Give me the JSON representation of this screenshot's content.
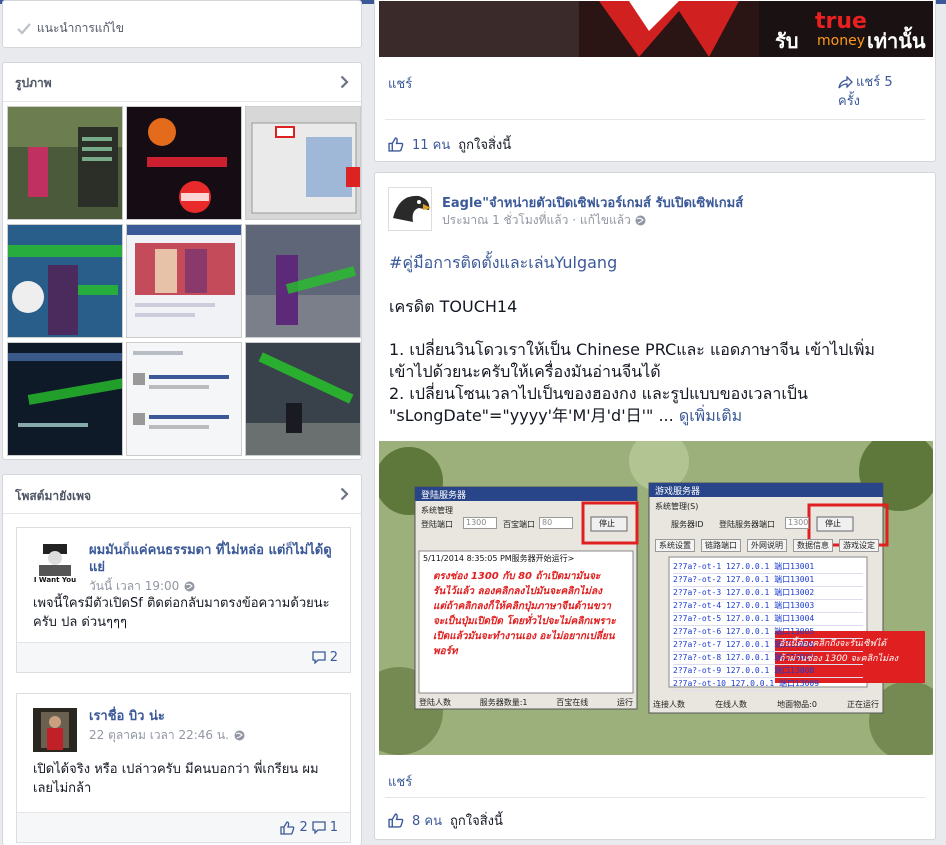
{
  "suggest": {
    "label": "แนะนำการแก้ไข"
  },
  "photos": {
    "title": "รูปภาพ"
  },
  "posts_to_page": {
    "title": "โพสต์มายังเพจ",
    "items": [
      {
        "name": "ผมมันก็แค่คนธรรมดา ที่ไม่หล่อ แต่ก็ไม่ได้ดูแย่",
        "time": "วันนี้ เวลา 19:00",
        "avatar_text": "I Want You",
        "message": "เพจนี้ใครมีตัวเปิดSf ติดต่อกลับมาตรงข้อความด้วยนะครับ ปล ด่วนๆๆๆ",
        "comments": "2"
      },
      {
        "name": "เราชื่อ บิว น่ะ",
        "time": "22 ตุลาคม เวลา 22:46 น.",
        "message": "เปิดได้จริง หรือ เปล่าวครับ มีคนบอกว่า พี่เกรียน ผมเลยไม่กล้า",
        "likes": "2",
        "comments": "1"
      }
    ]
  },
  "top_post": {
    "banner_text": "รับ",
    "banner_brand_top": "true",
    "banner_brand_bottom": "money",
    "banner_tail": "เท่านั้น",
    "share_label": "แชร์",
    "share_count_label": "แชร์ 5",
    "share_count_unit": "ครั้ง",
    "like_count": "11 คน",
    "like_text": "ถูกใจสิ่งนี้"
  },
  "main_post": {
    "author": "Eagle\"จำหน่ายตัวเปิดเซิฟเวอร์เกมส์ รับเปิดเซิฟเกมส์",
    "meta": "ประมาณ 1 ชั่วโมงที่แล้ว · แก้ไขแล้ว",
    "hashtag": "#คู่มือการติดตั้งและเล่นYulgang",
    "credit": "เครดิต TOUCH14",
    "line1": "1. เปลี่ยนวินโดวเราให้เป็น Chinese PRCและ แอดภาษาจีน เข้าไปเพิ่ม",
    "line2": "เข้าไปด้วยนะครับให้เครื่องมันอ่านจีนได้",
    "line3": "2. เปลี่ยนโซนเวลาไปเป็นของฮองกง และรูปแบบของเวลาเป็น",
    "line4_pre": "\"sLongDate\"=\"yyyy'年'M'月'd'日'\" ... ",
    "see_more": "ดูเพิ่มเติม",
    "share_label": "แชร์",
    "like_count": "8 คน",
    "like_text": "ถูกใจสิ่งนี้",
    "screenshot": {
      "left_window_title": "登陆服务器",
      "left_tab": "系统管理",
      "login_port_label": "登陆端口",
      "login_port_value": "1300",
      "server_port_label": "百宝端口",
      "server_port_value": "80",
      "stop_button": "停止",
      "log_line": "5/11/2014 8:35:05 PM服务器开始运行>",
      "overlay_text_1": "ตรงช่อง 1300 กับ 80 ถ้าเปิดมามันจะ",
      "overlay_text_2": "รันไว้แล้ว ลองคลิกลงไปมันจะคลิกไม่ลง",
      "overlay_text_3": "แต่ถ้าคลิกลงก็ให้คลิกปุ่มภาษาจีนด้านขวา",
      "overlay_text_4": "จะเป็นปุ่มเปิดปิด โดยทั่วไปจะไม่คลิกเพราะ",
      "overlay_text_5": "เปิดแล้วมันจะทำงานเอง อะไม่อยากเปลี่ยน",
      "overlay_text_6": "พอร์ท",
      "left_status_1": "登陆人数",
      "left_status_2": "服务器数量:1",
      "left_status_3": "百宝在线",
      "left_status_4": "运行",
      "right_window_title": "游戏服务器",
      "right_tab": "系统管理(S)",
      "right_port_label": "服务器ID",
      "right_server_port_label": "登陆服务器端口",
      "right_port_value": "1300",
      "right_stop_button": "停止",
      "right_tabs": [
        "系统设置",
        "链路端口",
        "外网说明",
        "数据信息",
        "游戏设定"
      ],
      "rows": [
        "2?7a?-ot-1 127.0.0.1 端口13001",
        "2?7a?-ot-2 127.0.0.1 端口13001",
        "2?7a?-ot-3 127.0.0.1 端口13002",
        "2?7a?-ot-4 127.0.0.1 端口13003",
        "2?7a?-ot-5 127.0.0.1 端口13004",
        "2?7a?-ot-6 127.0.0.1 端口13005",
        "2?7a?-ot-7 127.0.0.1 端口13006",
        "2?7a?-ot-8 127.0.0.1 端口13007",
        "2?7a?-ot-9 127.0.0.1 端口13008",
        "2?7a?-ot-10 127.0.0.1 端口13009"
      ],
      "red_note_1": "อันนี้ต้องคลิกถึงจะรันเซิฟได้",
      "red_note_2": "ถ้าผ่านช่อง 1300 จะคลิกไม่ลง",
      "right_status": [
        "连接人数",
        "在线人数",
        "地面物品:0",
        "正在运行"
      ]
    }
  },
  "colors": {
    "brand": "#3b5998",
    "muted": "#9197a3",
    "red_box": "#e02020"
  }
}
